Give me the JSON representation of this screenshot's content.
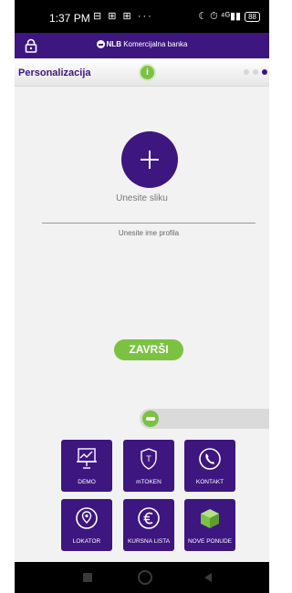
{
  "status_bar": {
    "time": "1:37 PM",
    "notification_icons": "⊟ ⊞ ⊞ ···",
    "right_icons": "☾ ⏱ ⁴ᴳ▮▮",
    "battery": "88"
  },
  "app_bar": {
    "brand_bold": "NLB",
    "brand_rest": " Komercijalna banka"
  },
  "title_bar": {
    "title": "Personalizacija",
    "info_glyph": "i",
    "pages": [
      false,
      false,
      true
    ]
  },
  "profile": {
    "add_photo_label": "Unesite sliku",
    "name_placeholder": "Unesite ime profila",
    "name_value": ""
  },
  "finish_button": "ZAVRŠI",
  "menu": {
    "demo": "DEMO",
    "mtoken": "mTOKEN",
    "kontakt": "KONTAKT",
    "lokator": "LOKATOR",
    "kursna_lista": "KURSNA LISTA",
    "nove_ponude": "NOVE PONUDE"
  },
  "colors": {
    "brand_purple": "#3d1680",
    "accent_green": "#7cc242",
    "background": "#f2f2f2"
  }
}
